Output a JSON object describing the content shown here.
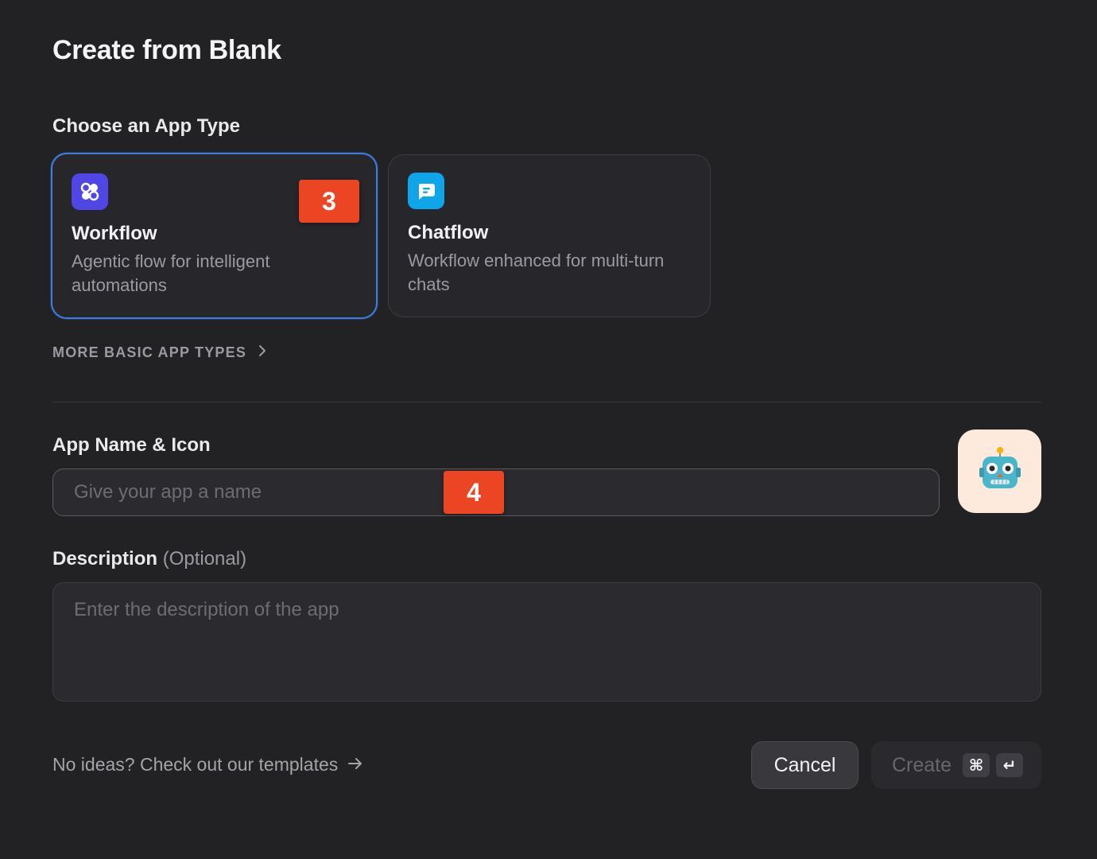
{
  "dialog": {
    "title": "Create from Blank"
  },
  "app_type": {
    "label": "Choose an App Type",
    "cards": [
      {
        "title": "Workflow",
        "description": "Agentic flow for intelligent automations",
        "icon": "workflow-icon",
        "icon_color": "#4f46e5",
        "selected": true
      },
      {
        "title": "Chatflow",
        "description": "Workflow enhanced for multi-turn chats",
        "icon": "chat-bubble-icon",
        "icon_color": "#0ea5e9",
        "selected": false
      }
    ],
    "more_types_label": "MORE BASIC APP TYPES"
  },
  "annotations": {
    "badge_3": "3",
    "badge_4": "4",
    "badge_color": "#ec4524"
  },
  "name_section": {
    "label": "App Name & Icon",
    "placeholder": "Give your app a name",
    "avatar_icon": "robot-icon",
    "avatar_bg": "#fdeadd"
  },
  "description_section": {
    "label": "Description",
    "optional": "(Optional)",
    "placeholder": "Enter the description of the app"
  },
  "footer": {
    "templates_link": "No ideas? Check out our templates",
    "cancel_label": "Cancel",
    "create_label": "Create",
    "shortcut_cmd": "⌘",
    "shortcut_enter": "↵"
  },
  "colors": {
    "background": "#222225",
    "selected_border": "#3b7de0"
  }
}
